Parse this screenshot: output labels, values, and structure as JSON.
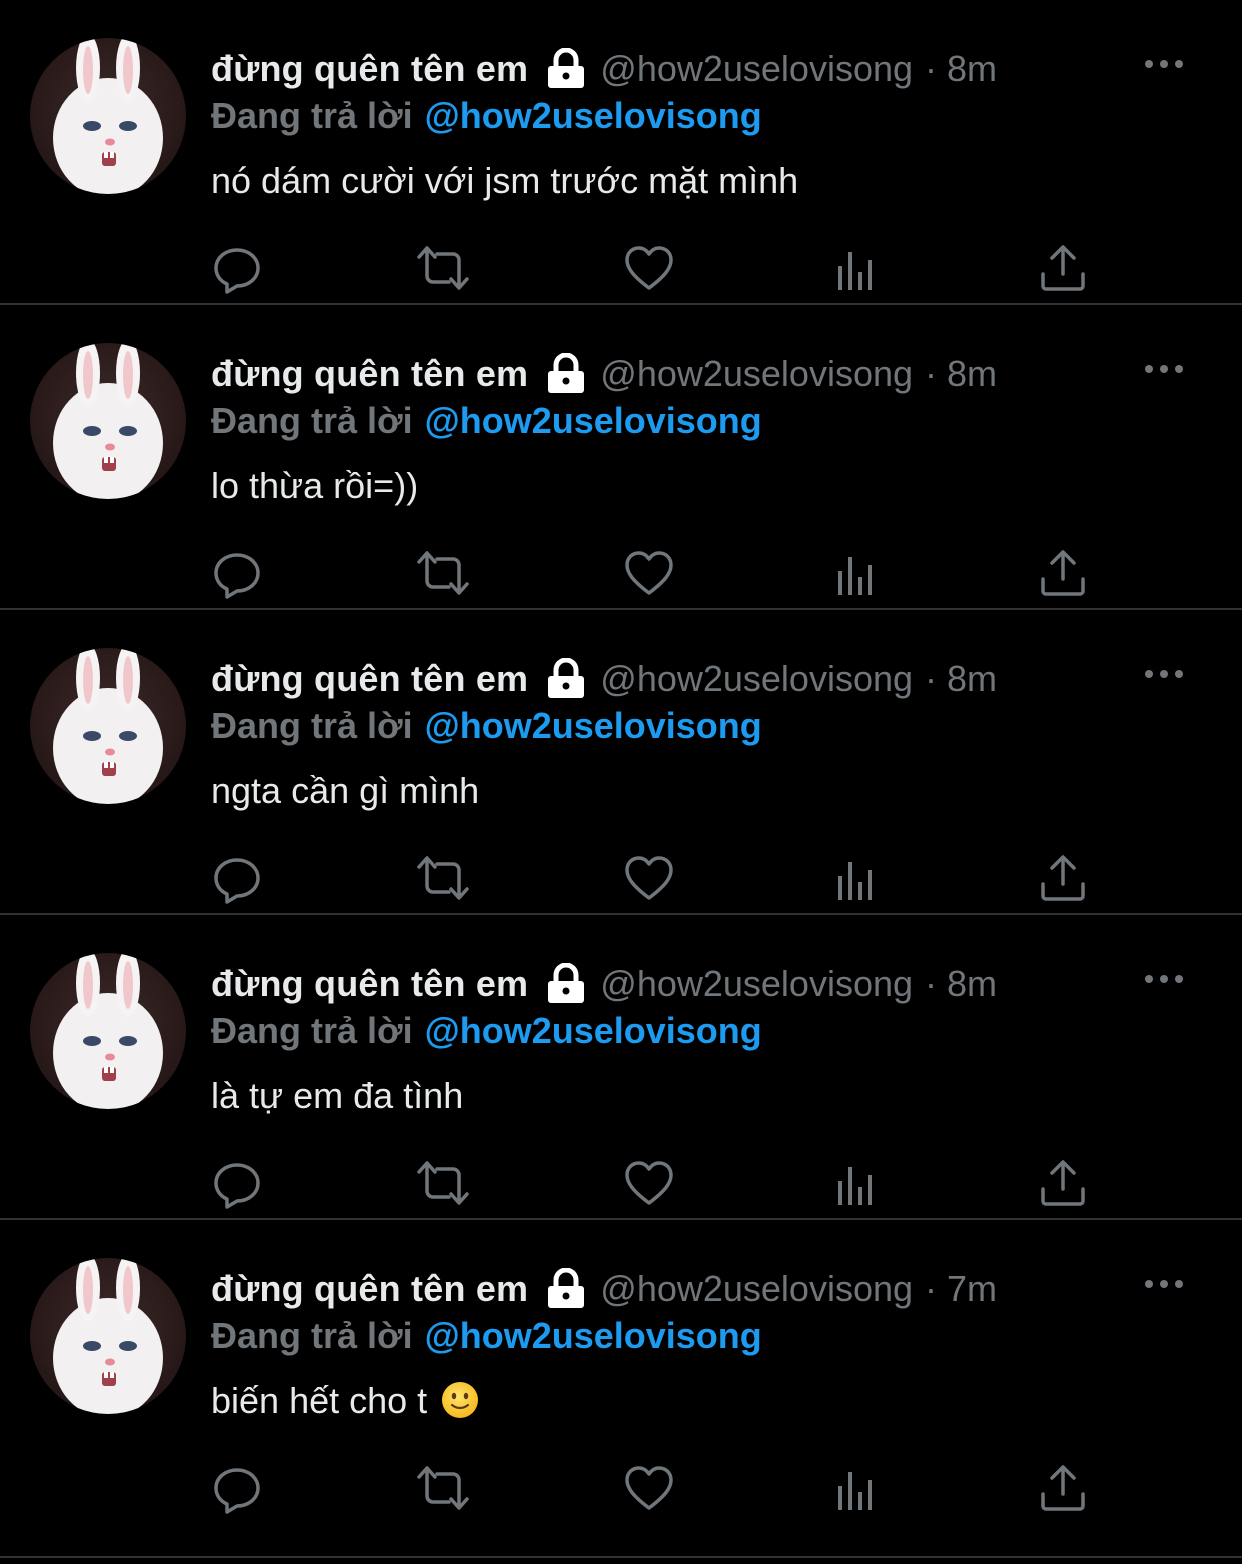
{
  "colors": {
    "background": "#000000",
    "name": "#e7e9ea",
    "muted": "#71767b",
    "accent": "#1d9bf0",
    "divider": "#2f3336"
  },
  "tweets": [
    {
      "name": "đừng quên tên em",
      "handle": "@how2uselovisong",
      "dot": "·",
      "time": "8m",
      "reply_prefix": "Đang trả lời",
      "reply_handle": "@how2uselovisong",
      "text": "nó dám cười với jsm trước mặt mình"
    },
    {
      "name": "đừng quên tên em",
      "handle": "@how2uselovisong",
      "dot": "·",
      "time": "8m",
      "reply_prefix": "Đang trả lời",
      "reply_handle": "@how2uselovisong",
      "text": "lo thừa rồi=))"
    },
    {
      "name": "đừng quên tên em",
      "handle": "@how2uselovisong",
      "dot": "·",
      "time": "8m",
      "reply_prefix": "Đang trả lời",
      "reply_handle": "@how2uselovisong",
      "text": "ngta cần gì mình"
    },
    {
      "name": "đừng quên tên em",
      "handle": "@how2uselovisong",
      "dot": "·",
      "time": "8m",
      "reply_prefix": "Đang trả lời",
      "reply_handle": "@how2uselovisong",
      "text": "là tự em đa tình"
    },
    {
      "name": "đừng quên tên em",
      "handle": "@how2uselovisong",
      "dot": "·",
      "time": "7m",
      "reply_prefix": "Đang trả lời",
      "reply_handle": "@how2uselovisong",
      "text": "biến hết cho t"
    }
  ],
  "icons": {
    "lock": "lock-icon",
    "more": "more-icon",
    "reply": "reply-icon",
    "retweet": "retweet-icon",
    "like": "heart-icon",
    "views": "analytics-icon",
    "share": "share-icon",
    "emoji": "slightly-smiling-face-emoji"
  }
}
